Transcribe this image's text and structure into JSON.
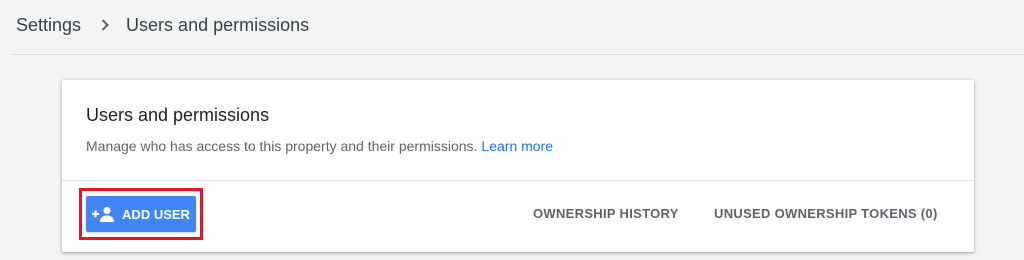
{
  "breadcrumb": {
    "root": "Settings",
    "separator_icon": "chevron-right-icon",
    "current": "Users and permissions"
  },
  "card": {
    "title": "Users and permissions",
    "description": "Manage who has access to this property and their permissions.",
    "learn_more": "Learn more"
  },
  "actions": {
    "add_user_label": "ADD USER",
    "add_user_icon": "person-add-icon",
    "ownership_history": "OWNERSHIP HISTORY",
    "unused_tokens": "UNUSED OWNERSHIP TOKENS (0)"
  },
  "colors": {
    "accent": "#4285f4",
    "link": "#1a73e8",
    "highlight": "#e3142a",
    "background": "#f1f3f4"
  }
}
